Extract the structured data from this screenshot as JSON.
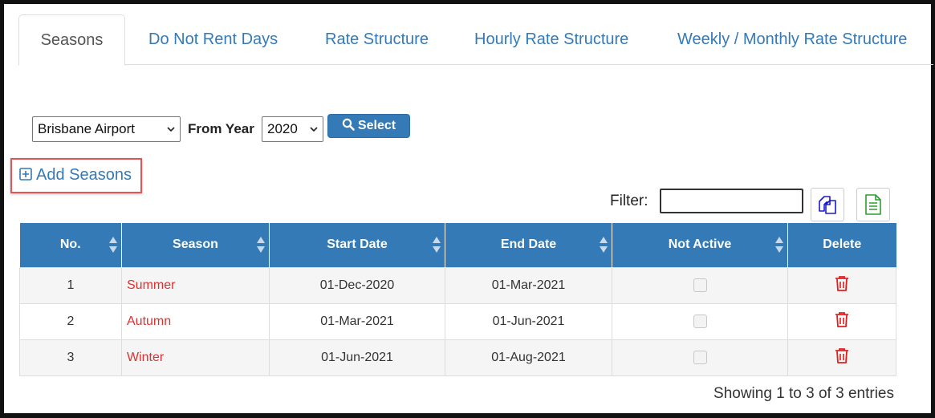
{
  "tabs": [
    {
      "label": "Seasons",
      "active": true
    },
    {
      "label": "Do Not Rent Days",
      "active": false
    },
    {
      "label": "Rate Structure",
      "active": false
    },
    {
      "label": "Hourly Rate Structure",
      "active": false
    },
    {
      "label": "Weekly / Monthly Rate Structure",
      "active": false
    }
  ],
  "controls": {
    "location_value": "Brisbane Airport",
    "from_year_label": "From Year",
    "year_value": "2020",
    "select_button": "Select"
  },
  "add_seasons_label": "Add Seasons",
  "filter": {
    "label": "Filter:",
    "value": ""
  },
  "table": {
    "headers": [
      "No.",
      "Season",
      "Start Date",
      "End Date",
      "Not Active",
      "Delete"
    ],
    "rows": [
      {
        "no": "1",
        "season": "Summer",
        "start": "01-Dec-2020",
        "end": "01-Mar-2021",
        "not_active": false
      },
      {
        "no": "2",
        "season": "Autumn",
        "start": "01-Mar-2021",
        "end": "01-Jun-2021",
        "not_active": false
      },
      {
        "no": "3",
        "season": "Winter",
        "start": "01-Jun-2021",
        "end": "01-Aug-2021",
        "not_active": false
      }
    ]
  },
  "info_text": "Showing 1 to 3 of 3 entries",
  "colors": {
    "primary": "#337ab7",
    "season_text": "#e03030",
    "delete_icon": "#e02020",
    "highlight_box": "#e05555",
    "excel_icon": "#2e9e2e"
  },
  "icons": {
    "search": "search-icon",
    "add": "plus-square-icon",
    "copy": "copy-icon",
    "excel": "file-excel-icon",
    "sort": "sort-icon",
    "delete": "trash-icon"
  }
}
